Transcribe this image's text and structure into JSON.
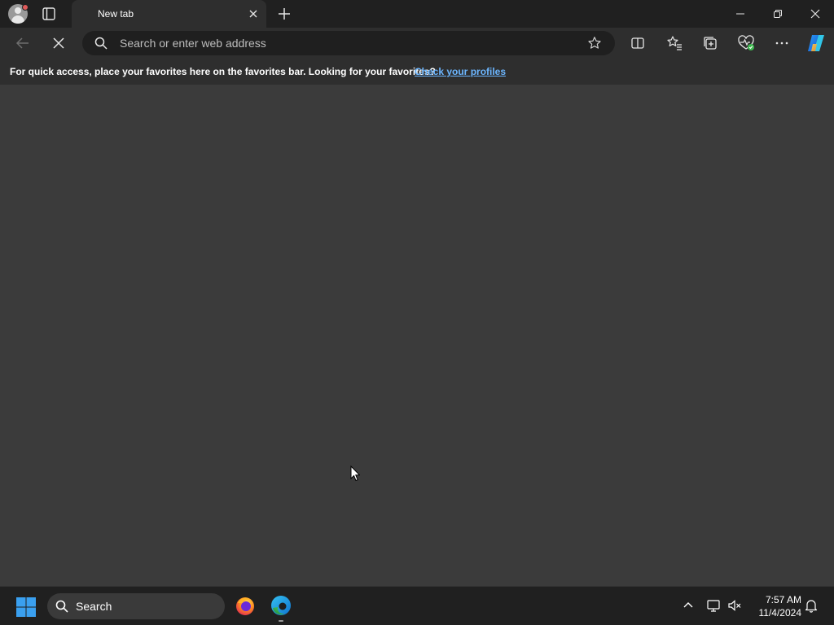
{
  "tab": {
    "title": "New tab"
  },
  "address_bar": {
    "placeholder": "Search or enter web address"
  },
  "favorites_bar": {
    "message": "For quick access, place your favorites here on the favorites bar. Looking for your favorites?",
    "link": "Check your profiles"
  },
  "taskbar": {
    "search_label": "Search",
    "time": "7:57 AM",
    "date": "11/4/2024"
  },
  "icons": [
    "profile-avatar-icon",
    "tab-actions-icon",
    "close-icon",
    "plus-icon",
    "minimize-icon",
    "restore-icon",
    "back-arrow-icon",
    "stop-loading-icon",
    "search-icon",
    "star-icon",
    "split-screen-icon",
    "favorites-icon",
    "collections-icon",
    "browser-essentials-icon",
    "more-icon",
    "copilot-icon",
    "windows-icon",
    "firefox-icon",
    "edge-icon",
    "chevron-up-icon",
    "display-icon",
    "muted-speaker-icon",
    "bell-icon"
  ],
  "colors": {
    "titlebar": "#202020",
    "toolbar": "#2e2e2e",
    "content": "#3b3b3b",
    "link": "#6cb6ff",
    "windows_blue": "#3aa0f0"
  }
}
